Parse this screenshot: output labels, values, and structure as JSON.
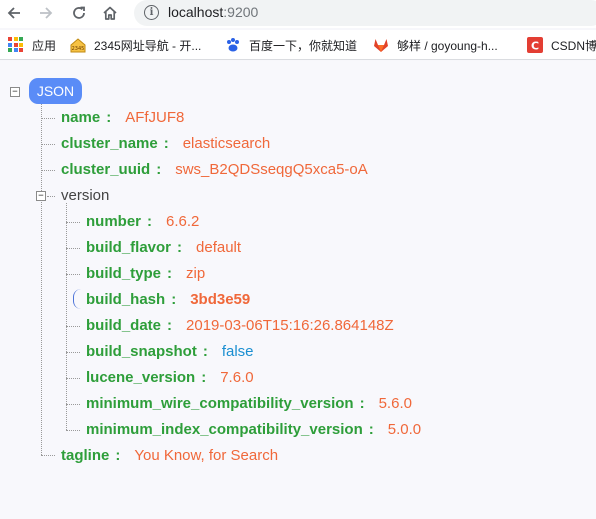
{
  "browser": {
    "url_host": "localhost",
    "url_port": ":9200"
  },
  "bookmarks": [
    {
      "label": "应用",
      "icon": "apps-grid-icon"
    },
    {
      "label": "2345网址导航 - 开...",
      "icon": "2345-home-icon"
    },
    {
      "label": "百度一下，你就知道",
      "icon": "baidu-paw-icon"
    },
    {
      "label": "够样 / goyoung-h...",
      "icon": "gitlab-fox-icon"
    },
    {
      "label": "CSDN博",
      "icon": "csdn-icon"
    }
  ],
  "colors": {
    "key": "#2e9e3a",
    "string_value": "#f0683a",
    "boolean_value": "#1b8fd1",
    "root_badge": "#5a8cf7"
  },
  "json_tree": {
    "root_label": "JSON",
    "root_expander": "−",
    "separator": ":",
    "name": {
      "key": "name",
      "value": "AFfJUF8"
    },
    "cluster_name": {
      "key": "cluster_name",
      "value": "elasticsearch"
    },
    "cluster_uuid": {
      "key": "cluster_uuid",
      "value": "sws_B2QDSseqgQ5xca5-oA"
    },
    "version": {
      "key": "version",
      "expander": "−",
      "number": {
        "key": "number",
        "value": "6.6.2"
      },
      "build_flavor": {
        "key": "build_flavor",
        "value": "default"
      },
      "build_type": {
        "key": "build_type",
        "value": "zip"
      },
      "build_hash": {
        "key": "build_hash",
        "value": "3bd3e59"
      },
      "build_date": {
        "key": "build_date",
        "value": "2019-03-06T15:16:26.864148Z"
      },
      "build_snapshot": {
        "key": "build_snapshot",
        "value": "false"
      },
      "lucene_version": {
        "key": "lucene_version",
        "value": "7.6.0"
      },
      "minimum_wire_compatibility_version": {
        "key": "minimum_wire_compatibility_version",
        "value": "5.6.0"
      },
      "minimum_index_compatibility_version": {
        "key": "minimum_index_compatibility_version",
        "value": "5.0.0"
      }
    },
    "tagline": {
      "key": "tagline",
      "value": "You Know, for Search"
    }
  }
}
